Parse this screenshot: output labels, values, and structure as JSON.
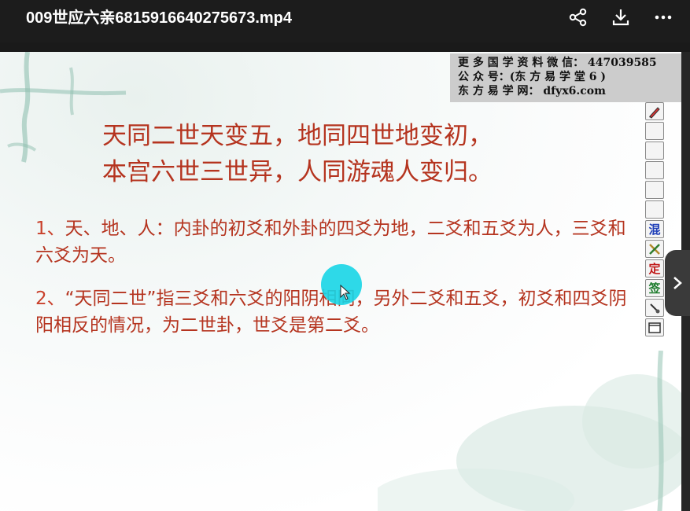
{
  "window": {
    "title": "009世应六亲6815916640275673.mp4"
  },
  "top_actions": [
    {
      "name": "share-icon",
      "label": "share"
    },
    {
      "name": "download-icon",
      "label": "download"
    },
    {
      "name": "more-icon",
      "label": "more"
    }
  ],
  "watermark": {
    "line1": "更 多 国 学 资 料 微 信： 447039585",
    "line2": "公 众 号：(东 方 易 学 堂 6 )",
    "line3": "东 方 易 学 网： dfyx6.com"
  },
  "slide": {
    "heading_line1": "天同二世天变五，地同四世地变初，",
    "heading_line2": "本宫六世三世异，人同游魂人变归。",
    "point1_num": "1、",
    "point1_text": "天、地、人：内卦的初爻和外卦的四爻为地，二爻和五爻为人，三爻和六爻为天。",
    "point2_num": "2、",
    "point2_text": "“天同二世”指三爻和六爻的阳阴相同，另外二爻和五爻，初爻和四爻阴阳相反的情况，为二世卦，世爻是第二爻。"
  },
  "toolbar": {
    "buttons": [
      {
        "name": "pen-tool-button",
        "label": ""
      },
      {
        "name": "tool-button-blank-1",
        "label": ""
      },
      {
        "name": "tool-button-blank-2",
        "label": ""
      },
      {
        "name": "tool-button-blank-3",
        "label": ""
      },
      {
        "name": "tool-button-blank-4",
        "label": ""
      },
      {
        "name": "tool-button-blank-5",
        "label": ""
      },
      {
        "name": "hun-button",
        "label": "混",
        "color": "#1f3fb8"
      },
      {
        "name": "cross-tool-button",
        "label": "",
        "color": "#b08a2a"
      },
      {
        "name": "ding-button",
        "label": "定",
        "color": "#c01818"
      },
      {
        "name": "qian-button",
        "label": "签",
        "color": "#1a7a2a"
      },
      {
        "name": "brush-tool-button",
        "label": ""
      },
      {
        "name": "window-tool-button",
        "label": ""
      }
    ]
  },
  "colors": {
    "text_red": "#b5341f",
    "cursor": "#17d5e6",
    "topbar": "#1c1c1c"
  },
  "icons": {
    "next": "chevron-right-icon"
  }
}
